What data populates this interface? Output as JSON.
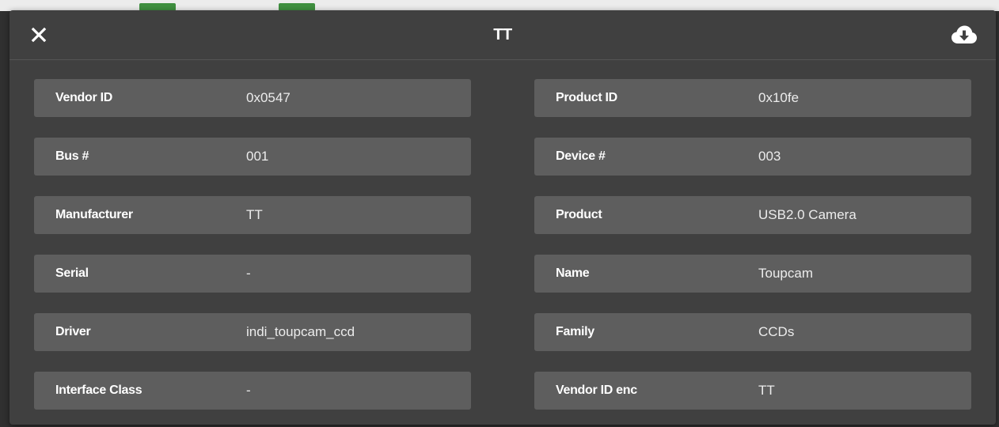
{
  "dialog": {
    "title": "TT",
    "close_icon": "close-icon",
    "download_icon": "cloud-download-icon"
  },
  "fields_left": [
    {
      "label": "Vendor ID",
      "value": "0x0547"
    },
    {
      "label": "Bus #",
      "value": "001"
    },
    {
      "label": "Manufacturer",
      "value": "TT"
    },
    {
      "label": "Serial",
      "value": "-"
    },
    {
      "label": "Driver",
      "value": "indi_toupcam_ccd"
    },
    {
      "label": "Interface Class",
      "value": "-"
    }
  ],
  "fields_right": [
    {
      "label": "Product ID",
      "value": "0x10fe"
    },
    {
      "label": "Device #",
      "value": "003"
    },
    {
      "label": "Product",
      "value": "USB2.0 Camera"
    },
    {
      "label": "Name",
      "value": "Toupcam"
    },
    {
      "label": "Family",
      "value": "CCDs"
    },
    {
      "label": "Vendor ID enc",
      "value": "TT"
    }
  ]
}
